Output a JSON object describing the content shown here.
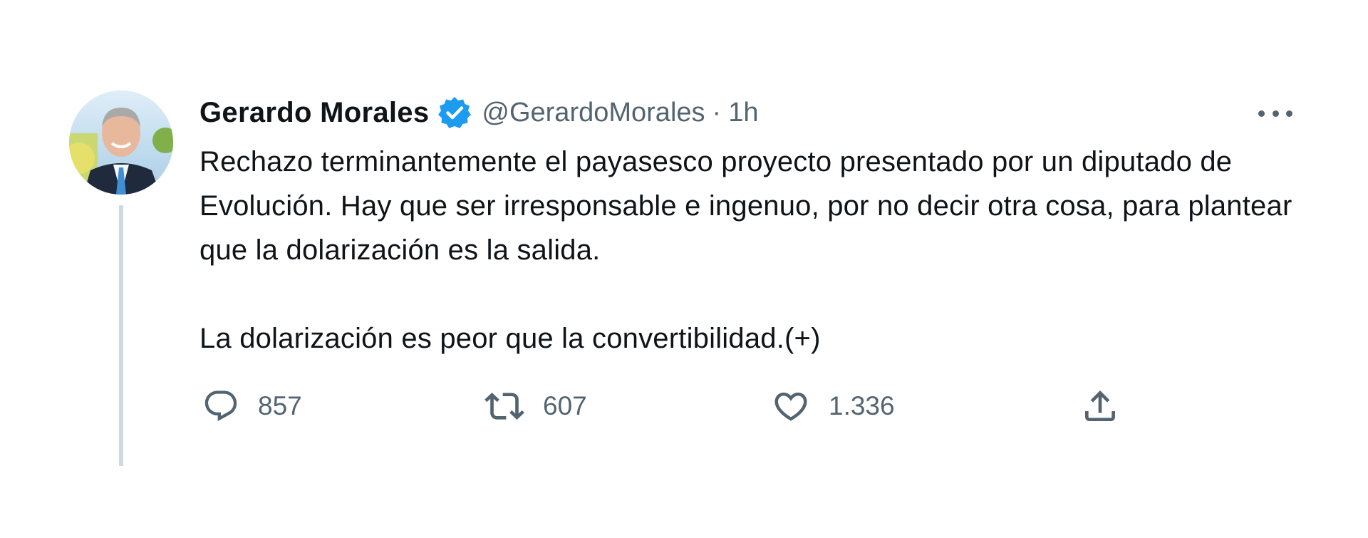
{
  "tweet": {
    "display_name": "Gerardo Morales",
    "verified": true,
    "handle": "@GerardoMorales",
    "separator": "·",
    "time": "1h",
    "text_paragraphs": [
      "Rechazo terminantemente el payasesco proyecto presentado por un diputado de Evolución. Hay que ser irresponsable e ingenuo, por no decir otra cosa, para plantear que la dolarización es la salida.",
      "La dolarización es peor que la convertibilidad.(+)"
    ]
  },
  "actions": {
    "reply_count": "857",
    "retweet_count": "607",
    "like_count": "1.336"
  },
  "icons": {
    "verified": "verified-badge-icon",
    "more": "more-options-icon",
    "reply": "reply-icon",
    "retweet": "retweet-icon",
    "like": "heart-icon",
    "share": "share-icon"
  },
  "colors": {
    "name": "#0f1419",
    "secondary": "#536471",
    "verified": "#1d9bf0",
    "thread_line": "#cfd9de"
  }
}
